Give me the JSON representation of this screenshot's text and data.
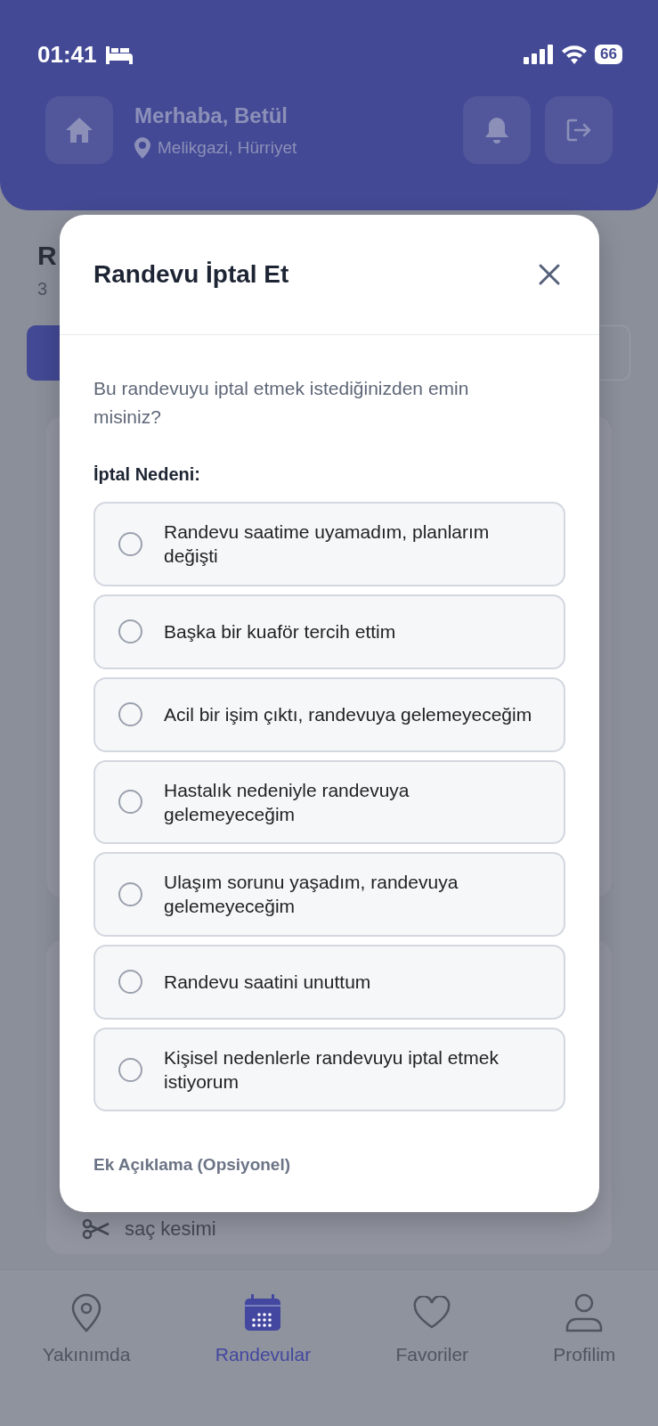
{
  "status_bar": {
    "time": "01:41",
    "battery": "66"
  },
  "header": {
    "greeting": "Merhaba, Betül",
    "location": "Melikgazi, Hürriyet"
  },
  "page_behind": {
    "title_fragment": "R",
    "subtitle_fragment": "3",
    "service": "saç kesimi"
  },
  "modal": {
    "title": "Randevu İptal Et",
    "question": "Bu randevuyu iptal etmek istediğinizden emin misiniz?",
    "reason_label": "İptal Nedeni:",
    "options": [
      {
        "label": "Randevu saatime uyamadım, planlarım değişti",
        "selected": false
      },
      {
        "label": "Başka bir kuaför tercih ettim",
        "selected": false
      },
      {
        "label": "Acil bir işim çıktı, randevuya gelemeyeceğim",
        "selected": false
      },
      {
        "label": "Hastalık nedeniyle randevuya gelemeyeceğim",
        "selected": false
      },
      {
        "label": "Ulaşım sorunu yaşadım, randevuya gelemeyeceğim",
        "selected": false
      },
      {
        "label": "Randevu saatini unuttum",
        "selected": false
      },
      {
        "label": "Kişisel nedenlerle randevuyu iptal etmek istiyorum",
        "selected": false
      }
    ],
    "note_label": "Ek Açıklama (Opsiyonel)"
  },
  "bottom_nav": [
    {
      "label": "Yakınımda",
      "kind": "pin",
      "selected": false
    },
    {
      "label": "Randevular",
      "kind": "calendar",
      "selected": true
    },
    {
      "label": "Favoriler",
      "kind": "heart",
      "selected": false
    },
    {
      "label": "Profilim",
      "kind": "person",
      "selected": false
    }
  ]
}
